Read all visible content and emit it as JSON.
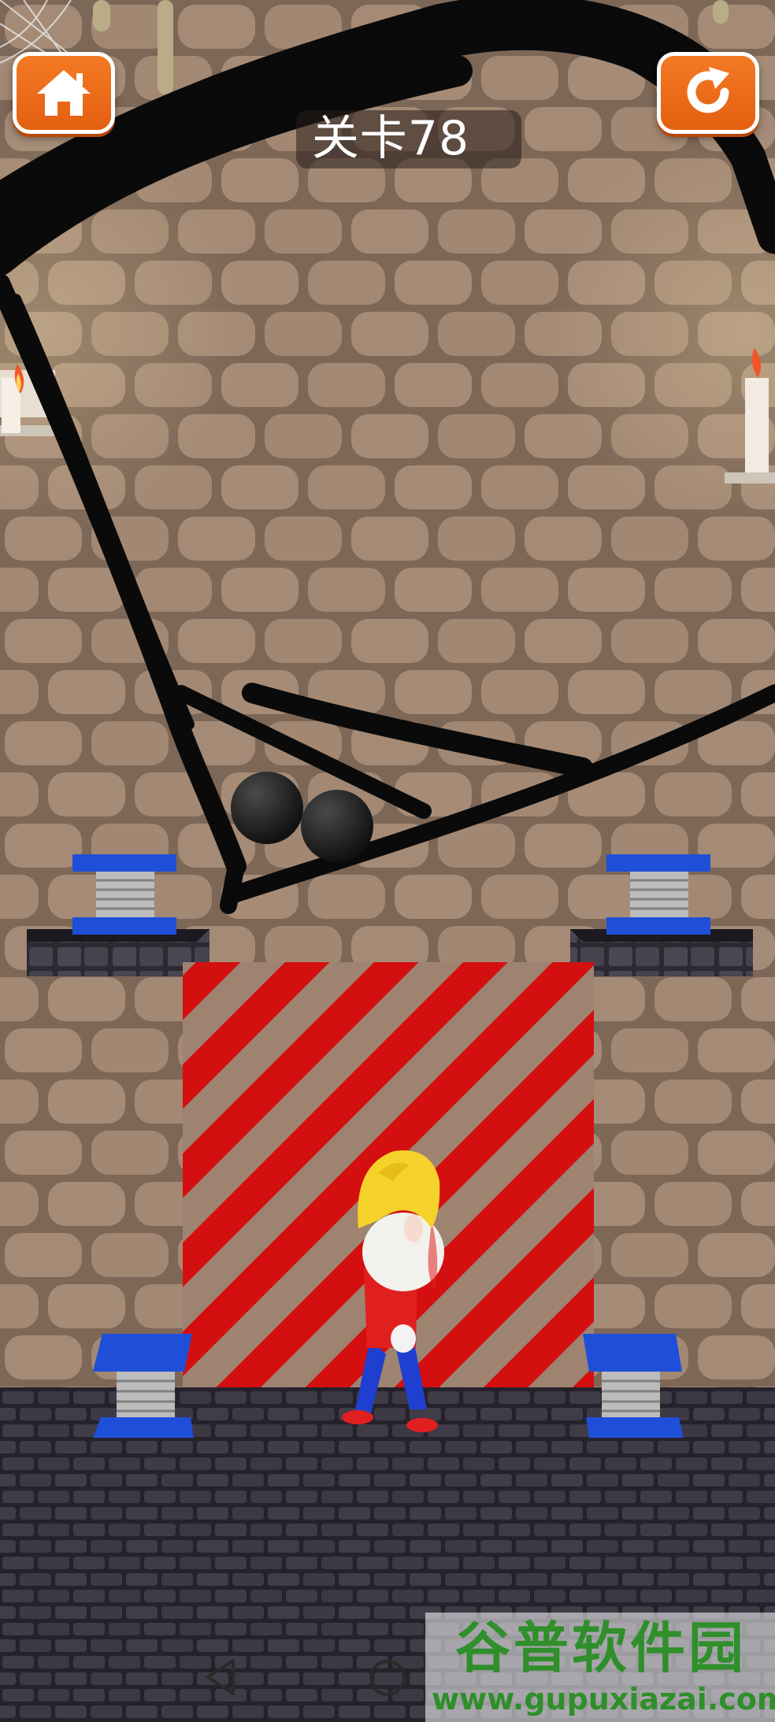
{
  "hud": {
    "level_label": "关卡78",
    "home_icon": "home-icon",
    "restart_icon": "restart-icon",
    "button_color": "#f0701c"
  },
  "scene": {
    "ball_count": 2,
    "spring_count": 4,
    "hazard_color": "#d40f10",
    "spring_color": "#1f4fd8"
  },
  "nav": {
    "back_icon": "back-triangle-icon",
    "home_icon": "home-circle-icon",
    "recents_icon": "recents-square-icon"
  },
  "watermark": {
    "title": "谷普软件园",
    "url": "www.gupuxiazai.com"
  }
}
